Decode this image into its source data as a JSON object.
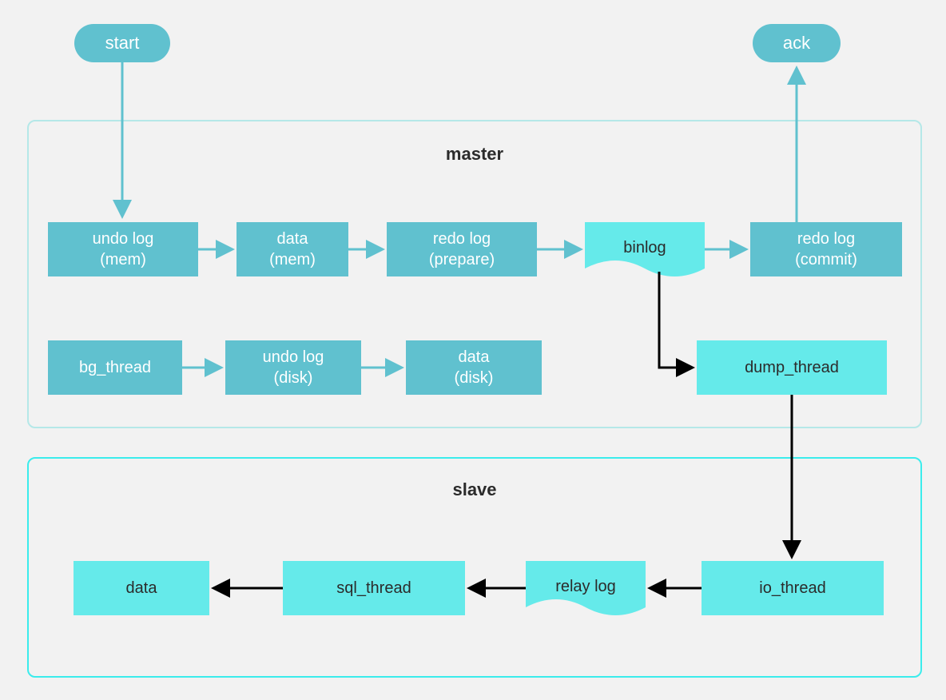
{
  "pills": {
    "start": "start",
    "ack": "ack"
  },
  "groups": {
    "master": "master",
    "slave": "slave"
  },
  "master_row1": {
    "undo_log_mem": {
      "l1": "undo log",
      "l2": "(mem)"
    },
    "data_mem": {
      "l1": "data",
      "l2": "(mem)"
    },
    "redo_prepare": {
      "l1": "redo log",
      "l2": "(prepare)"
    },
    "binlog": "binlog",
    "redo_commit": {
      "l1": "redo log",
      "l2": "(commit)"
    }
  },
  "master_row2": {
    "bg_thread": "bg_thread",
    "undo_log_disk": {
      "l1": "undo log",
      "l2": "(disk)"
    },
    "data_disk": {
      "l1": "data",
      "l2": "(disk)"
    },
    "dump_thread": "dump_thread"
  },
  "slave_row": {
    "data": "data",
    "sql_thread": "sql_thread",
    "relay_log": "relay log",
    "io_thread": "io_thread"
  },
  "colors": {
    "teal": "#60c1cf",
    "cyan": "#65eaea",
    "black": "#000000"
  }
}
